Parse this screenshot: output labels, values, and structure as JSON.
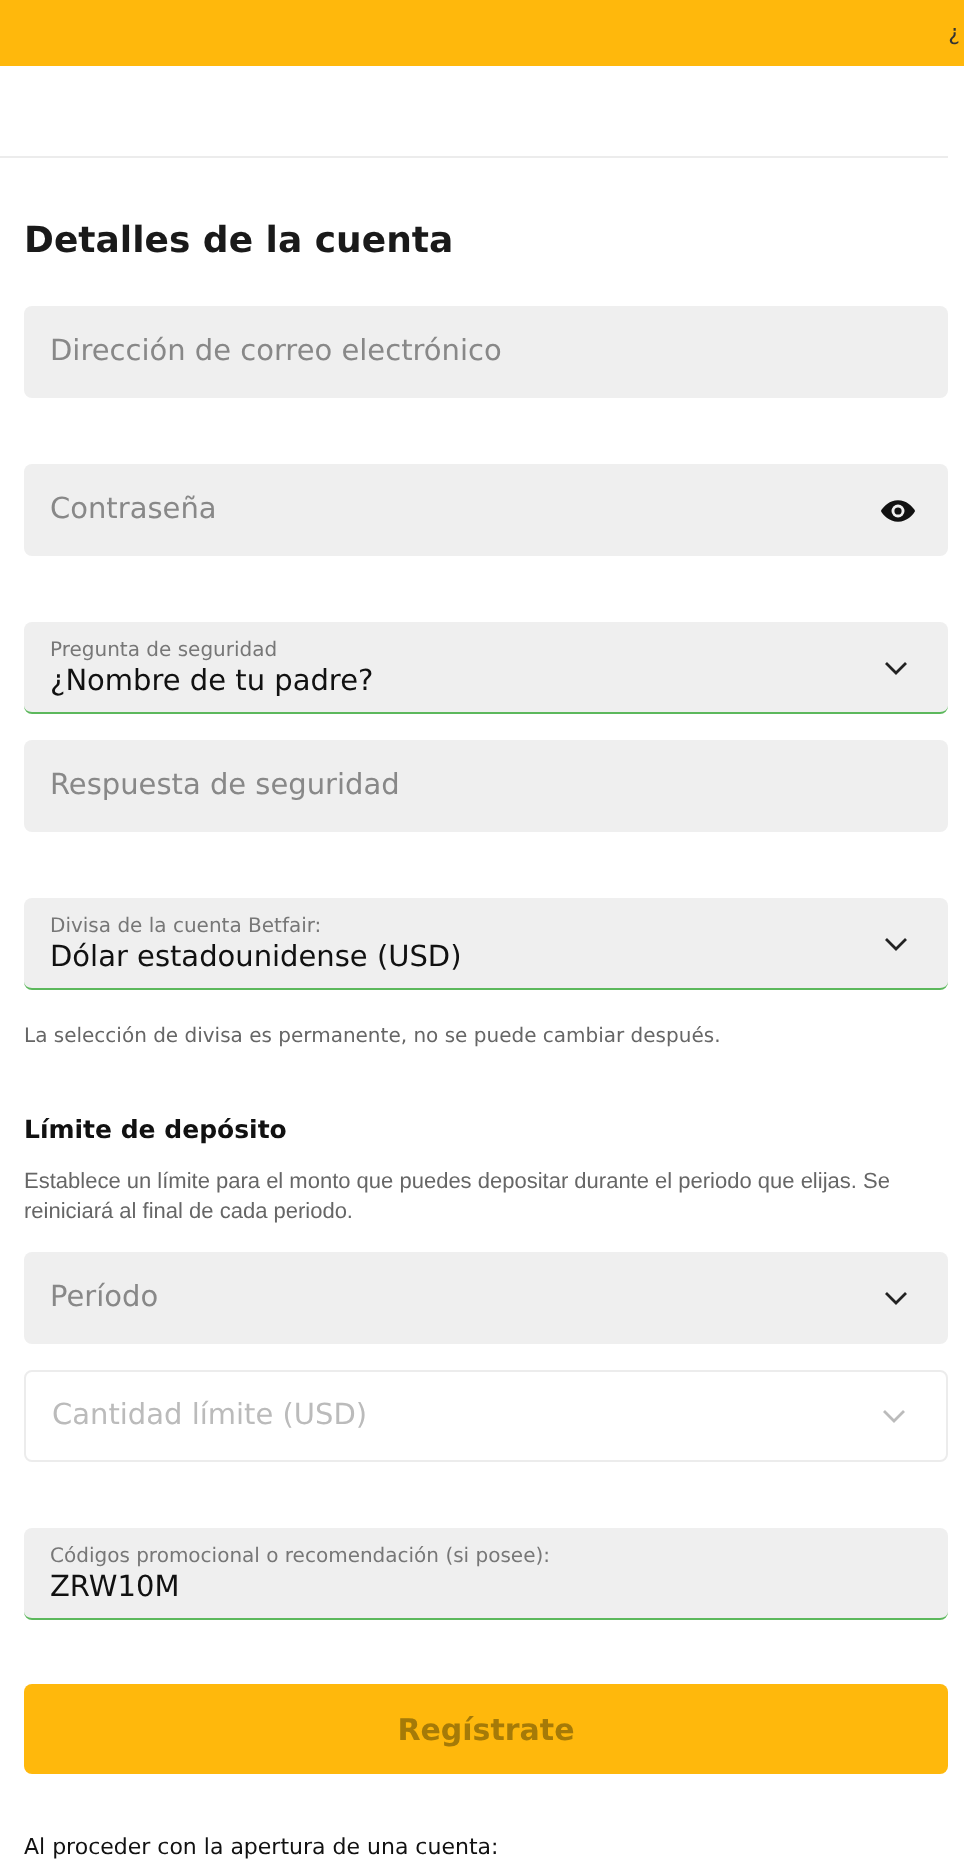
{
  "top_bar": {
    "text": "¿"
  },
  "section": {
    "title": "Detalles de la cuenta"
  },
  "fields": [
    {
      "kind": "text",
      "placeholder": "Dirección de correo electrónico"
    },
    {
      "kind": "password",
      "placeholder": "Contraseña"
    },
    {
      "kind": "select",
      "label": "Pregunta de seguridad",
      "value": "¿Nombre de tu padre?",
      "valid": true
    },
    {
      "kind": "text",
      "placeholder": "Respuesta de seguridad"
    },
    {
      "kind": "select",
      "label": "Divisa de la cuenta Betfair:",
      "value": "Dólar estadounidense (USD)",
      "valid": true
    }
  ],
  "currency_note": "La selección de divisa es permanente, no se puede cambiar después.",
  "deposit_limit": {
    "title": "Límite de depósito",
    "description": "Establece un límite para el monto que puedes depositar durante el periodo que elijas. Se reiniciará al final de cada periodo.",
    "fields": [
      {
        "kind": "select",
        "placeholder": "Período",
        "disabled": false
      },
      {
        "kind": "select",
        "placeholder": "Cantidad límite (USD)",
        "disabled": true
      }
    ]
  },
  "promo_field": {
    "kind": "text",
    "label": "Códigos promocional o recomendación (si posee):",
    "value": "ZRW10M",
    "valid": true
  },
  "submit_button": {
    "label": "Regístrate",
    "disabled": true
  },
  "footer_text": "Al proceder con la apertura de una cuenta:"
}
